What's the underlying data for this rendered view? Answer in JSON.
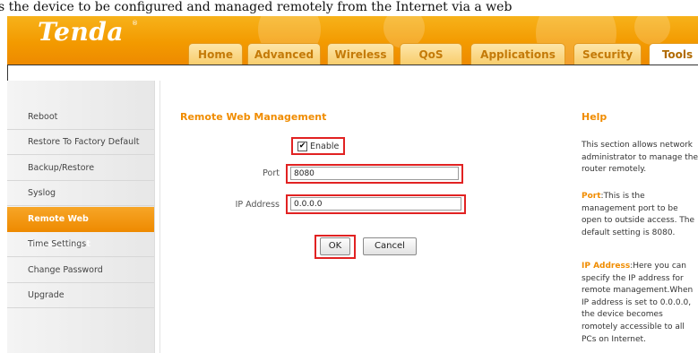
{
  "caption": "s the device to be configured and managed remotely from the Internet via a web",
  "brand": {
    "logo": "Tenda",
    "mark": "®"
  },
  "tabs": [
    {
      "label": "Home"
    },
    {
      "label": "Advanced"
    },
    {
      "label": "Wireless"
    },
    {
      "label": "QoS"
    },
    {
      "label": "Applications"
    },
    {
      "label": "Security"
    },
    {
      "label": "Tools"
    }
  ],
  "sidebar": {
    "items": [
      {
        "label": "Reboot"
      },
      {
        "label": "Restore To Factory Default"
      },
      {
        "label": "Backup/Restore"
      },
      {
        "label": "Syslog"
      },
      {
        "label": "Remote Web Management"
      },
      {
        "label": "Time Settings"
      },
      {
        "label": "Change Password"
      },
      {
        "label": "Upgrade"
      }
    ]
  },
  "main": {
    "title": "Remote Web Management",
    "enable": {
      "label": "Enable",
      "checked": true
    },
    "port": {
      "label": "Port",
      "value": "8080"
    },
    "ip": {
      "label": "IP Address",
      "value": "0.0.0.0"
    },
    "ok_label": "OK",
    "cancel_label": "Cancel"
  },
  "help": {
    "title": "Help",
    "intro": "This section allows network administrator to manage the router remotely.",
    "port_key": "Port",
    "port_text": ":This is the management port to be open to outside access. The default setting is 8080.",
    "ip_key": "IP Address",
    "ip_text": ":Here you can specify the IP address for remote management.When IP address is set to 0.0.0.0, the device becomes romotely accessible to all PCs on Internet."
  },
  "colors": {
    "accent": "#f08c00",
    "highlight_box": "#e12222"
  }
}
